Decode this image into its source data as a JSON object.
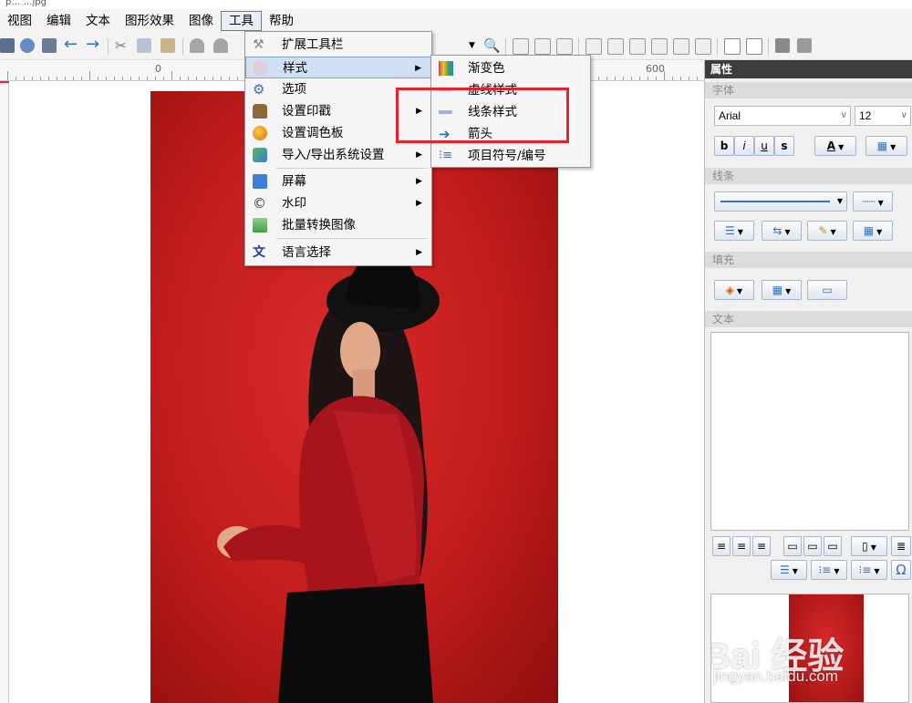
{
  "titlebar": {
    "text": "p… …jpg"
  },
  "menubar": {
    "items": [
      "视图",
      "编辑",
      "文本",
      "图形效果",
      "图像",
      "工具",
      "帮助"
    ],
    "active": "工具"
  },
  "ruler": {
    "labels": [
      "0",
      "600"
    ]
  },
  "tools_menu": {
    "items": [
      {
        "label": "扩展工具栏",
        "icon": "tools-icon",
        "submenu": false
      },
      {
        "label": "样式",
        "icon": "style-icon",
        "submenu": true,
        "highlighted": true
      },
      {
        "label": "选项",
        "icon": "gear-icon",
        "submenu": false
      },
      {
        "label": "设置印戳",
        "icon": "stamp-icon",
        "submenu": true
      },
      {
        "label": "设置调色板",
        "icon": "palette-icon",
        "submenu": false
      },
      {
        "label": "导入/导出系统设置",
        "icon": "import-export-icon",
        "submenu": true
      },
      {
        "label": "屏幕",
        "icon": "monitor-icon",
        "submenu": true
      },
      {
        "label": "水印",
        "icon": "copyright-icon",
        "submenu": true
      },
      {
        "label": "批量转换图像",
        "icon": "batch-convert-icon",
        "submenu": false
      },
      {
        "label": "语言选择",
        "icon": "language-icon",
        "submenu": true
      }
    ]
  },
  "style_submenu": {
    "items": [
      {
        "label": "渐变色",
        "icon": "gradient-icon"
      },
      {
        "label": "虚线样式",
        "icon": "dashed-line-icon"
      },
      {
        "label": "线条样式",
        "icon": "line-style-icon"
      },
      {
        "label": "箭头",
        "icon": "arrow-icon"
      },
      {
        "label": "项目符号/编号",
        "icon": "bullet-list-icon"
      }
    ]
  },
  "panel": {
    "title": "属性",
    "font_section": "字体",
    "font_name": "Arial",
    "font_size": "12",
    "bold": "b",
    "italic": "i",
    "underline": "u",
    "strike": "s",
    "color_a": "A",
    "line_section": "线条",
    "fill_section": "填充",
    "text_section": "文本",
    "omega": "Ω"
  },
  "watermark": {
    "text": "Bai 经验",
    "sub": "jingyan.baidu.com"
  },
  "colors": {
    "highlight_box": "#e8212b",
    "menu_highlight": "#cfe0f5",
    "photo_bg": "#c11c1c"
  }
}
